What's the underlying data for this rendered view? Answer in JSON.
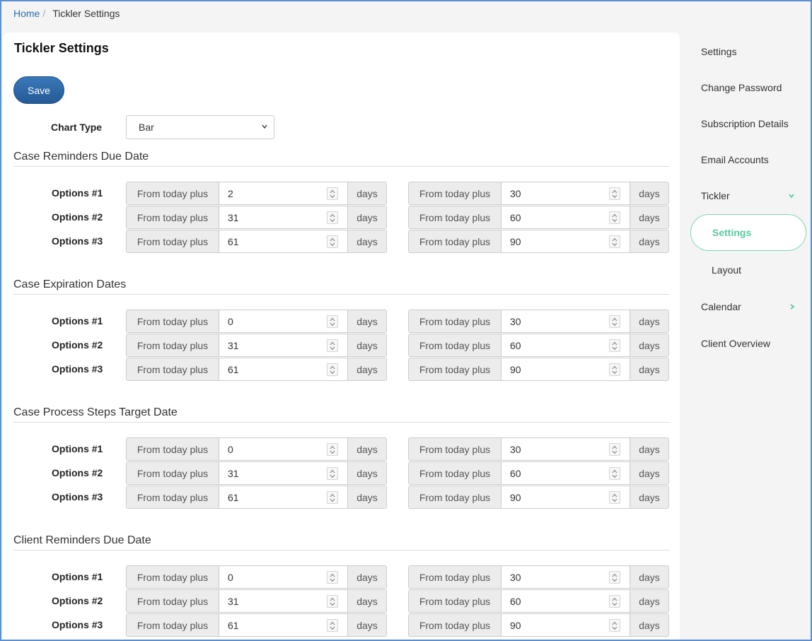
{
  "breadcrumb": {
    "home": "Home",
    "separator": "/",
    "current": "Tickler Settings"
  },
  "page": {
    "title": "Tickler Settings",
    "save_label": "Save"
  },
  "chart_type": {
    "label": "Chart Type",
    "value": "Bar"
  },
  "labels": {
    "prefix": "From today plus",
    "suffix": "days"
  },
  "sections": [
    {
      "title": "Case Reminders Due Date",
      "options": [
        {
          "label": "Options #1",
          "from": "2",
          "to": "30"
        },
        {
          "label": "Options #2",
          "from": "31",
          "to": "60"
        },
        {
          "label": "Options #3",
          "from": "61",
          "to": "90"
        }
      ]
    },
    {
      "title": "Case Expiration Dates",
      "options": [
        {
          "label": "Options #1",
          "from": "0",
          "to": "30"
        },
        {
          "label": "Options #2",
          "from": "31",
          "to": "60"
        },
        {
          "label": "Options #3",
          "from": "61",
          "to": "90"
        }
      ]
    },
    {
      "title": "Case Process Steps Target Date",
      "options": [
        {
          "label": "Options #1",
          "from": "0",
          "to": "30"
        },
        {
          "label": "Options #2",
          "from": "31",
          "to": "60"
        },
        {
          "label": "Options #3",
          "from": "61",
          "to": "90"
        }
      ]
    },
    {
      "title": "Client Reminders Due Date",
      "options": [
        {
          "label": "Options #1",
          "from": "0",
          "to": "30"
        },
        {
          "label": "Options #2",
          "from": "31",
          "to": "60"
        },
        {
          "label": "Options #3",
          "from": "61",
          "to": "90"
        }
      ]
    }
  ],
  "sidebar": {
    "items": [
      {
        "label": "Settings"
      },
      {
        "label": "Change Password"
      },
      {
        "label": "Subscription Details"
      },
      {
        "label": "Email Accounts"
      },
      {
        "label": "Tickler",
        "icon": "chevron-down-icon"
      },
      {
        "label": "Settings",
        "active": true
      },
      {
        "label": "Layout"
      },
      {
        "label": "Calendar",
        "icon": "chevron-right-icon"
      },
      {
        "label": "Client Overview"
      }
    ],
    "accent_color": "#5cc99e"
  }
}
